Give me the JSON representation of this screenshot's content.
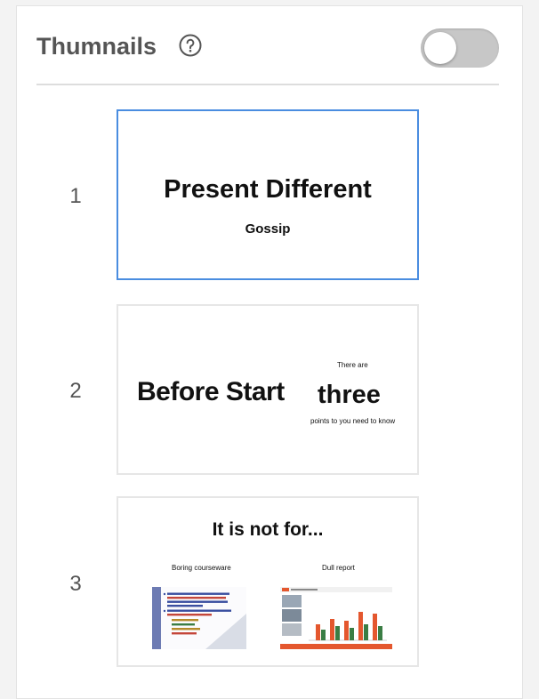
{
  "header": {
    "title": "Thumnails",
    "help_icon": "question-circle-icon",
    "toggle_on": false
  },
  "slides": [
    {
      "number": "1",
      "selected": true,
      "title": "Present Different",
      "subtitle": "Gossip"
    },
    {
      "number": "2",
      "selected": false,
      "left_text": "Before Start",
      "right_small_top": "There are",
      "right_big": "three",
      "right_small_bottom": "points to you need to know"
    },
    {
      "number": "3",
      "selected": false,
      "title": "It is not for...",
      "left_caption": "Boring courseware",
      "right_caption": "Dull report"
    }
  ],
  "colors": {
    "selected_border": "#4a8de0",
    "bar_orange": "#e4572e",
    "bar_green": "#3a7d44"
  }
}
